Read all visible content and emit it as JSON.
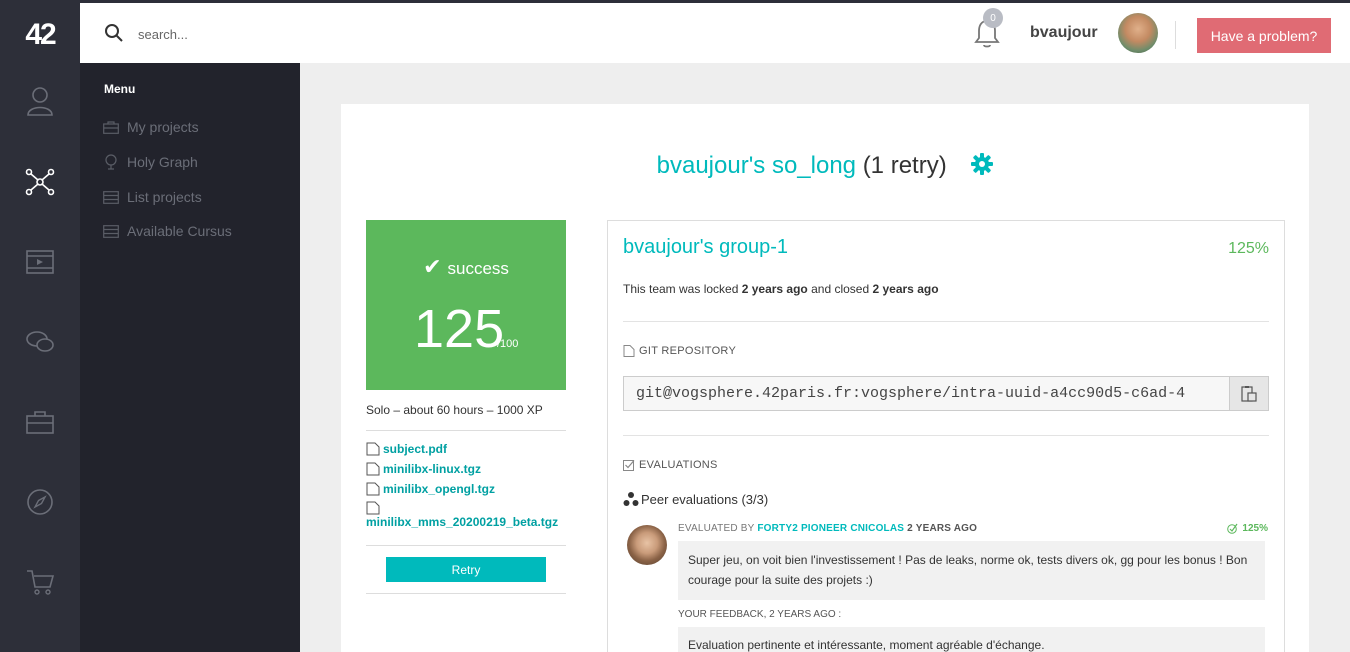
{
  "app": {
    "logo": "42"
  },
  "rail": {
    "items": [
      "profile-icon",
      "holy-graph-icon",
      "elearning-icon",
      "forum-icon",
      "companies-icon",
      "compass-icon",
      "shop-icon"
    ]
  },
  "topbar": {
    "search_placeholder": "search...",
    "notifications_count": "0",
    "username": "bvaujour",
    "problem_button": "Have a problem?"
  },
  "menu": {
    "title": "Menu",
    "items": [
      {
        "label": "My projects",
        "icon": "briefcase-icon"
      },
      {
        "label": "Holy Graph",
        "icon": "globe-icon"
      },
      {
        "label": "List projects",
        "icon": "list-icon"
      },
      {
        "label": "Available Cursus",
        "icon": "list-icon"
      }
    ]
  },
  "project": {
    "title_link": "bvaujour's so_long",
    "title_suffix": "(1 retry)",
    "status": "success",
    "score": "125",
    "score_max": "/100",
    "meta": "Solo – about 60 hours – 1000 XP",
    "attachments": [
      "subject.pdf",
      "minilibx-linux.tgz",
      "minilibx_opengl.tgz",
      "minilibx_mms_20200219_beta.tgz"
    ],
    "retry_button": "Retry",
    "status_color": "#5cb85c",
    "accent_color": "#00babc"
  },
  "group": {
    "name": "bvaujour's group-1",
    "score": "125%",
    "lock_prefix": "This team was locked ",
    "locked_ago": "2 years ago",
    "lock_mid": " and closed ",
    "closed_ago": "2 years ago",
    "git_header": "GIT REPOSITORY",
    "git_url": "git@vogsphere.42paris.fr:vogsphere/intra-uuid-a4cc90d5-c6ad-4",
    "evaluations_header": "EVALUATIONS",
    "peer_label": "Peer evaluations (3/3)",
    "evaluation": {
      "evaluated_by_label": "EVALUATED BY",
      "evaluator": "FORTY2 PIONEER CNICOLAS",
      "when": "2 YEARS AGO",
      "score": "125%",
      "comment": "Super jeu, on voit bien l'investissement ! Pas de leaks, norme ok, tests divers ok, gg pour les bonus ! Bon courage pour la suite des projets :)",
      "feedback_label": "YOUR FEEDBACK, 2 YEARS AGO :",
      "feedback": "Evaluation pertinente et intéressante, moment agréable d'échange."
    }
  }
}
